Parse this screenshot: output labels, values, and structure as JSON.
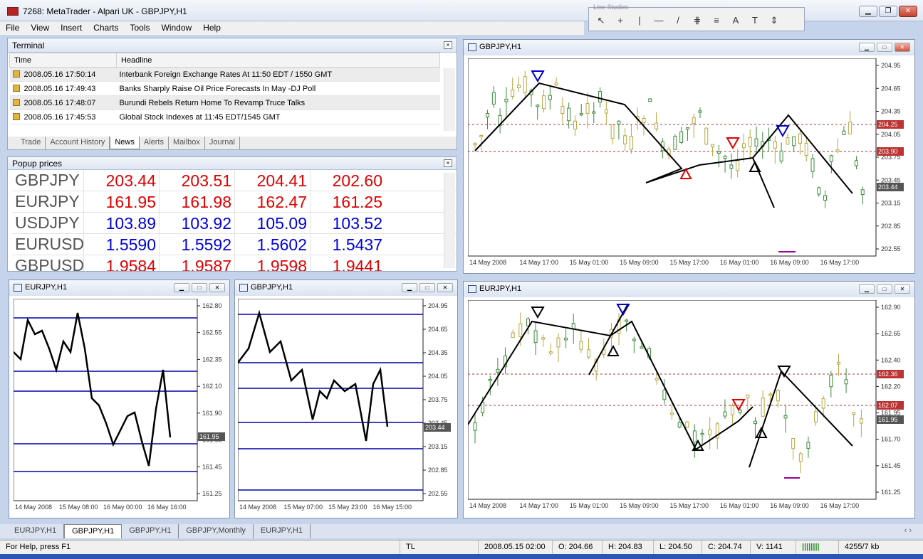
{
  "window": {
    "title": "7268: MetaTrader - Alpari UK - GBPJPY,H1",
    "buttons": [
      "▁",
      "❐",
      "✕"
    ]
  },
  "menu": [
    "File",
    "View",
    "Insert",
    "Charts",
    "Tools",
    "Window",
    "Help"
  ],
  "toolbar": {
    "title": "Line Studies",
    "items": [
      "↖",
      "+",
      "|",
      "—",
      "/",
      "⋕",
      "≡",
      "A",
      "T",
      "⇕"
    ]
  },
  "terminal": {
    "title": "Terminal",
    "columns": [
      "Time",
      "Headline"
    ],
    "rows": [
      {
        "time": "2008.05.16 17:50:14",
        "headline": "Interbank Foreign Exchange Rates At 11:50 EDT / 1550 GMT"
      },
      {
        "time": "2008.05.16 17:49:43",
        "headline": "Banks Sharply Raise Oil Price Forecasts In May -DJ Poll"
      },
      {
        "time": "2008.05.16 17:48:07",
        "headline": "Burundi Rebels Return Home To Revamp Truce Talks"
      },
      {
        "time": "2008.05.16 17:45:53",
        "headline": "Global Stock Indexes at 11:45 EDT/1545 GMT"
      }
    ],
    "tabs": [
      "Trade",
      "Account History",
      "News",
      "Alerts",
      "Mailbox",
      "Journal"
    ],
    "active_tab": "News"
  },
  "popup": {
    "title": "Popup prices",
    "rows": [
      {
        "symbol": "GBPJPY",
        "values": [
          "203.44",
          "203.51",
          "204.41",
          "202.60"
        ],
        "color": "red"
      },
      {
        "symbol": "EURJPY",
        "values": [
          "161.95",
          "161.98",
          "162.47",
          "161.25"
        ],
        "color": "red"
      },
      {
        "symbol": "USDJPY",
        "values": [
          "103.89",
          "103.92",
          "105.09",
          "103.52"
        ],
        "color": "blue"
      },
      {
        "symbol": "EURUSD",
        "values": [
          "1.5590",
          "1.5592",
          "1.5602",
          "1.5437"
        ],
        "color": "blue"
      },
      {
        "symbol": "GBPUSD",
        "values": [
          "1.9584",
          "1.9587",
          "1.9598",
          "1.9441"
        ],
        "color": "red"
      }
    ]
  },
  "charts": {
    "gbpjpy_top": {
      "title": "GBPJPY,H1",
      "yticks": [
        "204.95",
        "204.65",
        "204.35",
        "204.05",
        "203.75",
        "203.45",
        "203.15",
        "202.85",
        "202.55"
      ],
      "price_labels": [
        "204.25",
        "203.90",
        "203.44"
      ],
      "xticks": [
        "14 May 2008",
        "14 May 17:00",
        "15 May 01:00",
        "15 May 09:00",
        "15 May 17:00",
        "16 May 01:00",
        "16 May 09:00",
        "16 May 17:00"
      ]
    },
    "eurjpy_left": {
      "title": "EURJPY,H1",
      "yticks": [
        "162.80",
        "162.55",
        "162.35",
        "162.10",
        "161.90",
        "161.65",
        "161.45",
        "161.25"
      ],
      "price_label": "161.95",
      "xticks": [
        "14 May 2008",
        "15 May 08:00",
        "16 May 00:00",
        "16 May 16:00"
      ]
    },
    "gbpjpy_mid": {
      "title": "GBPJPY,H1",
      "yticks": [
        "204.95",
        "204.65",
        "204.35",
        "204.05",
        "203.75",
        "203.45",
        "203.15",
        "202.85",
        "202.55"
      ],
      "price_label": "203.44",
      "xticks": [
        "14 May 2008",
        "15 May 07:00",
        "15 May 23:00",
        "16 May 15:00"
      ]
    },
    "eurjpy_right": {
      "title": "EURJPY,H1",
      "yticks": [
        "162.90",
        "162.65",
        "162.40",
        "162.20",
        "161.95",
        "161.70",
        "161.45",
        "161.25"
      ],
      "price_labels": [
        "162.36",
        "162.07",
        "161.95"
      ],
      "xticks": [
        "14 May 2008",
        "14 May 17:00",
        "15 May 01:00",
        "15 May 09:00",
        "15 May 17:00",
        "16 May 01:00",
        "16 May 09:00",
        "16 May 17:00"
      ]
    }
  },
  "bottom_tabs": [
    "EURJPY,H1",
    "GBPJPY,H1",
    "GBPJPY,H1",
    "GBPJPY,Monthly",
    "EURJPY,H1"
  ],
  "bottom_active": "GBPJPY,H1",
  "status": {
    "help": "For Help, press F1",
    "profile": "TL",
    "date": "2008.05.15 02:00",
    "open": "O: 204.66",
    "high": "H: 204.83",
    "low": "L: 204.50",
    "close": "C: 204.74",
    "volume": "V: 1141",
    "traffic": "4255/7 kb"
  }
}
